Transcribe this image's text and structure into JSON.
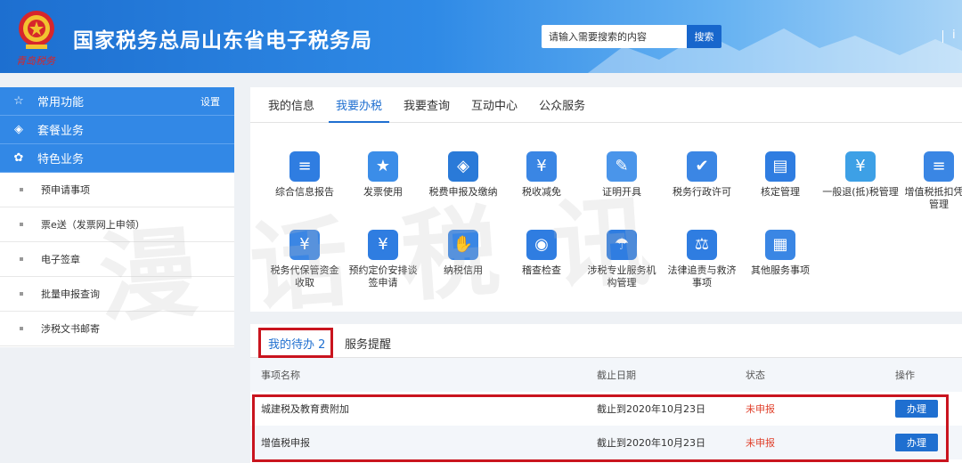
{
  "header": {
    "emblem_caption": "青岛税务",
    "title": "国家税务总局山东省电子税务局",
    "search_placeholder": "请输入需要搜索的内容",
    "search_button": "搜索",
    "more": "i"
  },
  "sidebar": {
    "groups": [
      {
        "label": "常用功能",
        "icon": "star-icon",
        "extra": "设置"
      },
      {
        "label": "套餐业务",
        "icon": "layers-icon"
      },
      {
        "label": "特色业务",
        "icon": "flower-icon"
      }
    ],
    "items": [
      {
        "label": "预申请事项"
      },
      {
        "label": "票e送（发票网上申领）"
      },
      {
        "label": "电子签章"
      },
      {
        "label": "批量申报查询"
      },
      {
        "label": "涉税文书邮寄"
      }
    ]
  },
  "main": {
    "tabs": [
      {
        "label": "我的信息"
      },
      {
        "label": "我要办税",
        "active": true
      },
      {
        "label": "我要查询"
      },
      {
        "label": "互动中心"
      },
      {
        "label": "公众服务"
      }
    ],
    "services": [
      {
        "label": "综合信息报告",
        "icon": "document-icon",
        "color": "#2f7de1"
      },
      {
        "label": "发票使用",
        "icon": "invoice-icon",
        "color": "#3b8de8"
      },
      {
        "label": "税费申报及缴纳",
        "icon": "stack-icon",
        "color": "#2a7ad8"
      },
      {
        "label": "税收减免",
        "icon": "yuan-ticket-icon",
        "color": "#3a86e4"
      },
      {
        "label": "证明开具",
        "icon": "pen-icon",
        "color": "#4a95ea"
      },
      {
        "label": "税务行政许可",
        "icon": "permit-icon",
        "color": "#3b86e4"
      },
      {
        "label": "核定管理",
        "icon": "folder-icon",
        "color": "#2f7de1"
      },
      {
        "label": "一般退(抵)税管理",
        "icon": "refund-hand-icon",
        "color": "#3da0e6"
      },
      {
        "label": "增值税抵扣凭证管理",
        "icon": "voucher-icon",
        "color": "#3a86e4"
      },
      {
        "label": "税务代保管资金收取",
        "icon": "fund-icon",
        "color": "#3b86e4"
      },
      {
        "label": "预约定价安排谈签申请",
        "icon": "chart-coin-icon",
        "color": "#2f7de1"
      },
      {
        "label": "纳税信用",
        "icon": "thumb-up-icon",
        "color": "#3a86e4"
      },
      {
        "label": "稽查检查",
        "icon": "inspect-icon",
        "color": "#2f7de1"
      },
      {
        "label": "涉税专业服务机构管理",
        "icon": "umbrella-icon",
        "color": "#2f7de1"
      },
      {
        "label": "法律追责与救济事项",
        "icon": "gavel-icon",
        "color": "#2f7de1"
      },
      {
        "label": "其他服务事项",
        "icon": "apps-icon",
        "color": "#3a86e4"
      }
    ]
  },
  "todo": {
    "tabs": [
      {
        "label": "我的待办 2",
        "active": true
      },
      {
        "label": "服务提醒"
      }
    ],
    "columns": [
      "事项名称",
      "截止日期",
      "状态",
      "操作"
    ],
    "rows": [
      {
        "name": "城建税及教育费附加",
        "deadline": "截止到2020年10月23日",
        "status": "未申报",
        "action": "办理"
      },
      {
        "name": "增值税申报",
        "deadline": "截止到2020年10月23日",
        "status": "未申报",
        "action": "办理"
      }
    ]
  },
  "watermark": "漫话税讯"
}
